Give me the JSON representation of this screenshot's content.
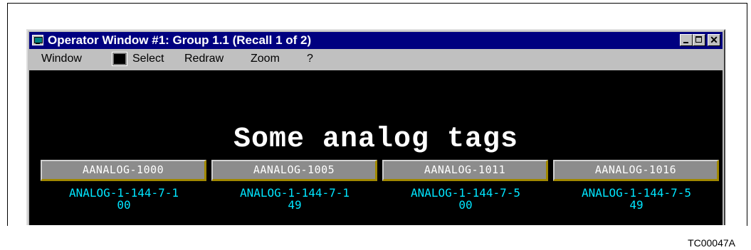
{
  "window": {
    "title": "Operator Window #1: Group 1.1 (Recall 1 of 2)",
    "controls": {
      "minimize": "",
      "maximize": "",
      "close": "✕"
    }
  },
  "menubar": {
    "items": [
      "Window",
      "Select",
      "Redraw",
      "Zoom",
      "?"
    ],
    "swatch_color": "#000000"
  },
  "display": {
    "heading": "Some analog tags",
    "tag_buttons": [
      "AANALOG-1000",
      "AANALOG-1005",
      "AANALOG-1011",
      "AANALOG-1016"
    ],
    "tag_values": [
      {
        "line1": "ANALOG-1-144-7-1",
        "line2": "00"
      },
      {
        "line1": "ANALOG-1-144-7-1",
        "line2": "49"
      },
      {
        "line1": "ANALOG-1-144-7-5",
        "line2": "00"
      },
      {
        "line1": "ANALOG-1-144-7-5",
        "line2": "49"
      }
    ],
    "colors": {
      "background": "#000000",
      "heading": "#ffffff",
      "values": "#00e5ff",
      "button_bg": "#8c8c8c"
    }
  },
  "figure_id": "TC00047A"
}
